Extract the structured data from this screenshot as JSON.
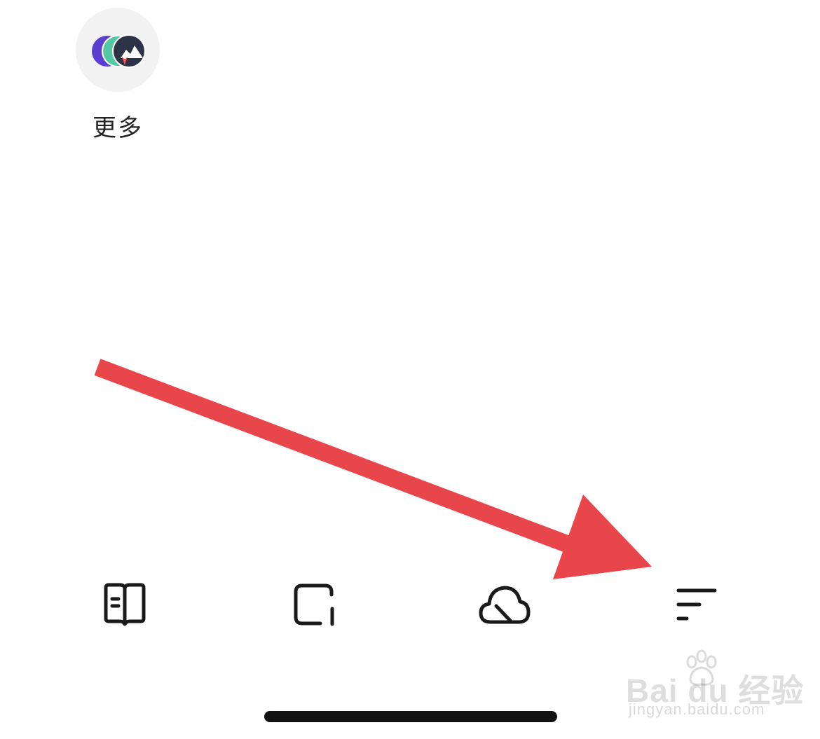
{
  "more_app": {
    "label": "更多",
    "icon": "app-stack-icon"
  },
  "toolbar": [
    {
      "icon": "book-icon"
    },
    {
      "icon": "square-corner-icon"
    },
    {
      "icon": "cloud-icon"
    },
    {
      "icon": "menu-lines-icon"
    }
  ],
  "annotation": {
    "icon": "red-arrow-annotation",
    "color": "#e8464b"
  },
  "watermark": {
    "logo": "Bai du 经验",
    "subtitle": "jingyan.baidu.com"
  }
}
